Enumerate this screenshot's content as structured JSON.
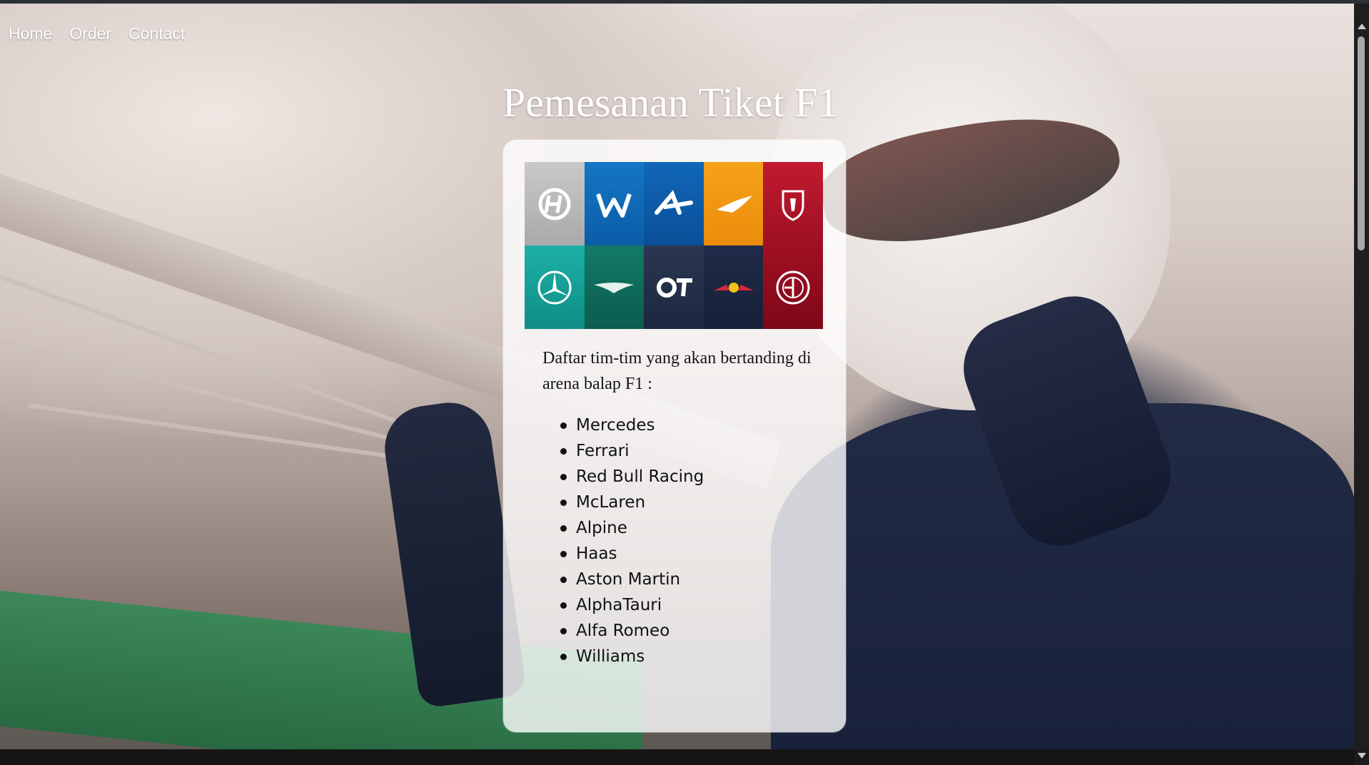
{
  "nav": {
    "items": [
      "Home",
      "Order",
      "Contact"
    ]
  },
  "page": {
    "title": "Pemesanan Tiket F1",
    "intro": "Daftar tim-tim yang akan bertanding di arena balap F1 :"
  },
  "teams": [
    "Mercedes",
    "Ferrari",
    "Red Bull Racing",
    "McLaren",
    "Alpine",
    "Haas",
    "Aston Martin",
    "AlphaTauri",
    "Alfa Romeo",
    "Williams"
  ],
  "logo_grid": {
    "tiles": [
      {
        "icon": "haas-logo-icon",
        "color": "#b9b9b9"
      },
      {
        "icon": "williams-logo-icon",
        "color": "#0b67b7"
      },
      {
        "icon": "alpine-logo-icon",
        "color": "#0a58a8"
      },
      {
        "icon": "mclaren-logo-icon",
        "color": "#f39212"
      },
      {
        "icon": "ferrari-logo-icon",
        "color": "#b0152a"
      },
      {
        "icon": "mercedes-logo-icon",
        "color": "#12a29a"
      },
      {
        "icon": "aston-martin-logo-icon",
        "color": "#0e6a5a"
      },
      {
        "icon": "alphatauri-logo-icon",
        "color": "#243049"
      },
      {
        "icon": "red-bull-logo-icon",
        "color": "#1a2540"
      },
      {
        "icon": "alfa-romeo-logo-icon",
        "color": "#8e0b1d"
      }
    ]
  },
  "colors": {
    "title_text": "#ffffff",
    "card_background": "rgba(255,255,255,0.80)"
  }
}
